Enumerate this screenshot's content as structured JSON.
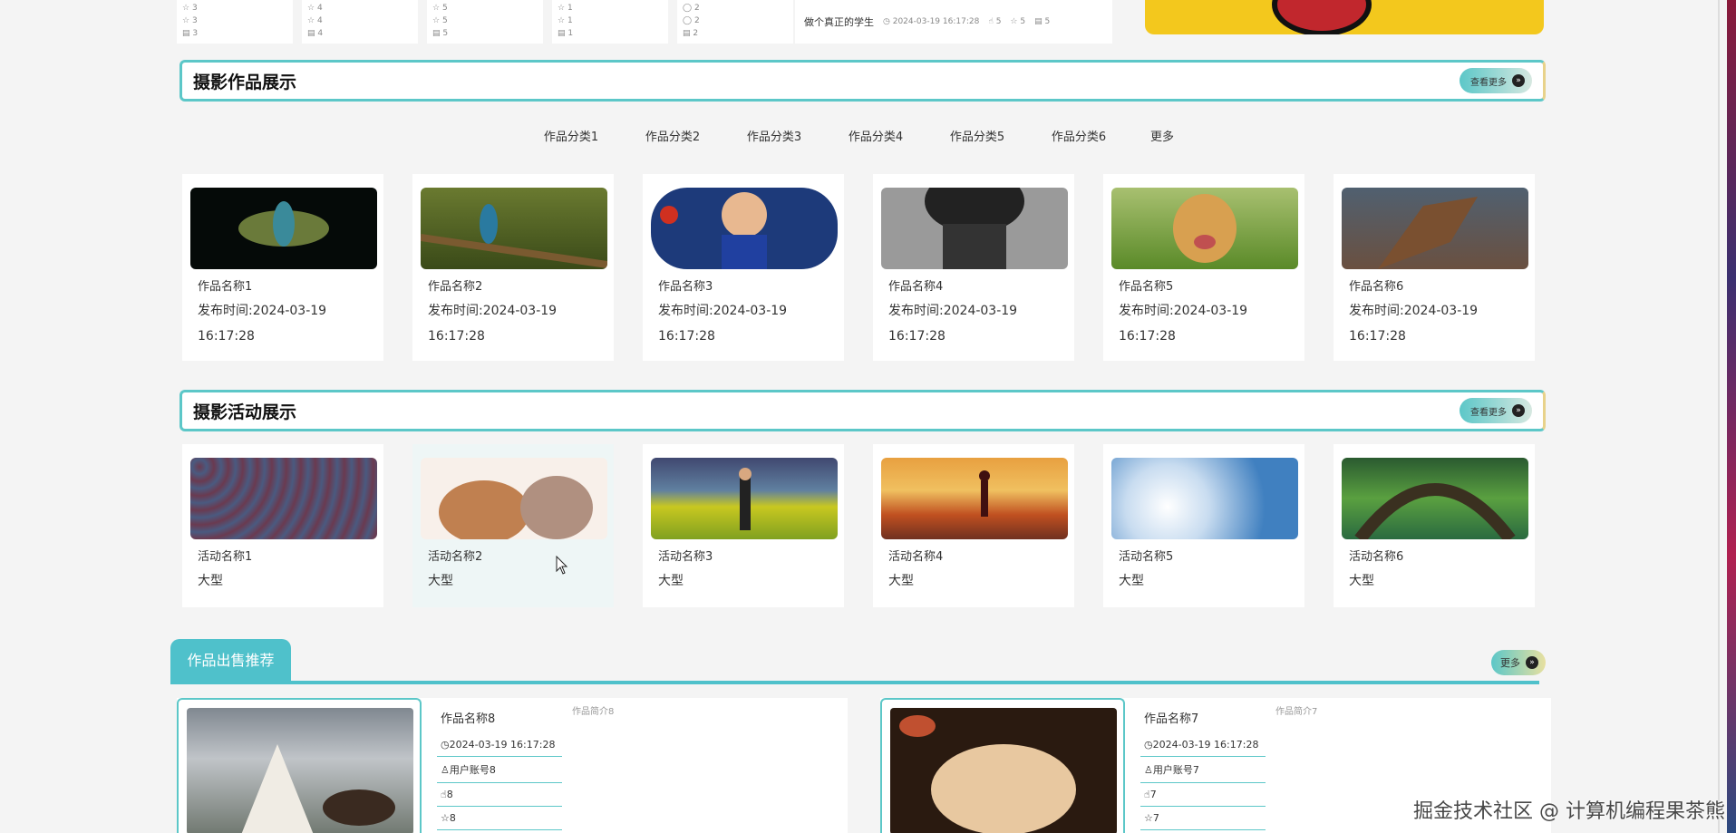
{
  "top_stats": [
    {
      "a": "3",
      "b": "3",
      "c": "3"
    },
    {
      "a": "4",
      "b": "4",
      "c": "4"
    },
    {
      "a": "5",
      "b": "5",
      "c": "5"
    },
    {
      "a": "1",
      "b": "1",
      "c": "1"
    },
    {
      "a": "2",
      "b": "2",
      "c": "2"
    }
  ],
  "top_news": {
    "title": "做个真正的学生",
    "time": "2024-03-19 16:17:28",
    "n1": "5",
    "n2": "5",
    "n3": "5"
  },
  "works_section": {
    "title": "摄影作品展示",
    "more": "查看更多"
  },
  "categories": [
    "作品分类1",
    "作品分类2",
    "作品分类3",
    "作品分类4",
    "作品分类5",
    "作品分类6",
    "更多"
  ],
  "works": [
    {
      "name": "作品名称1",
      "date": "发布时间:2024-03-19",
      "time": "16:17:28"
    },
    {
      "name": "作品名称2",
      "date": "发布时间:2024-03-19",
      "time": "16:17:28"
    },
    {
      "name": "作品名称3",
      "date": "发布时间:2024-03-19",
      "time": "16:17:28"
    },
    {
      "name": "作品名称4",
      "date": "发布时间:2024-03-19",
      "time": "16:17:28"
    },
    {
      "name": "作品名称5",
      "date": "发布时间:2024-03-19",
      "time": "16:17:28"
    },
    {
      "name": "作品名称6",
      "date": "发布时间:2024-03-19",
      "time": "16:17:28"
    }
  ],
  "activities_section": {
    "title": "摄影活动展示",
    "more": "查看更多"
  },
  "activities": [
    {
      "name": "活动名称1",
      "type": "大型"
    },
    {
      "name": "活动名称2",
      "type": "大型"
    },
    {
      "name": "活动名称3",
      "type": "大型"
    },
    {
      "name": "活动名称4",
      "type": "大型"
    },
    {
      "name": "活动名称5",
      "type": "大型"
    },
    {
      "name": "活动名称6",
      "type": "大型"
    }
  ],
  "sale_section": {
    "title": "作品出售推荐",
    "more": "更多"
  },
  "sales": [
    {
      "name": "作品名称8",
      "time": "2024-03-19 16:17:28",
      "user": "用户账号8",
      "likes": "8",
      "favs": "8",
      "desc": "作品简介8"
    },
    {
      "name": "作品名称7",
      "time": "2024-03-19 16:17:28",
      "user": "用户账号7",
      "likes": "7",
      "favs": "7",
      "desc": "作品简介7"
    }
  ],
  "watermark": "掘金技术社区 @ 计算机编程果茶熊"
}
